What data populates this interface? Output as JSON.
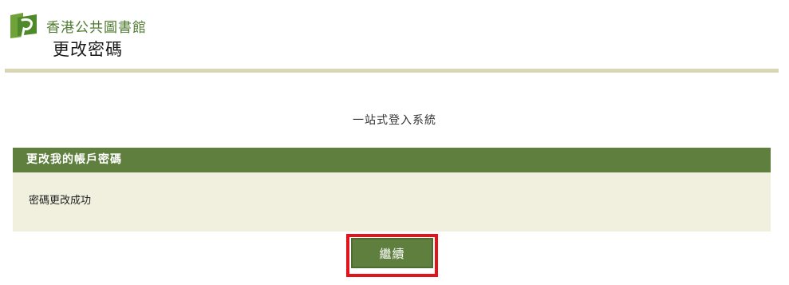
{
  "header": {
    "logo_icon": "hkpl-logo-icon",
    "org_name": "香港公共圖書館",
    "page_title": "更改密碼"
  },
  "system_title": "一站式登入系統",
  "panel": {
    "title": "更改我的帳戶密碼",
    "message": "密碼更改成功"
  },
  "actions": {
    "continue_label": "繼續"
  },
  "colors": {
    "brand_green": "#5e7f3e",
    "panel_bg": "#f1f0de",
    "rule": "#d8d6b4",
    "highlight_red": "#e2131b"
  }
}
